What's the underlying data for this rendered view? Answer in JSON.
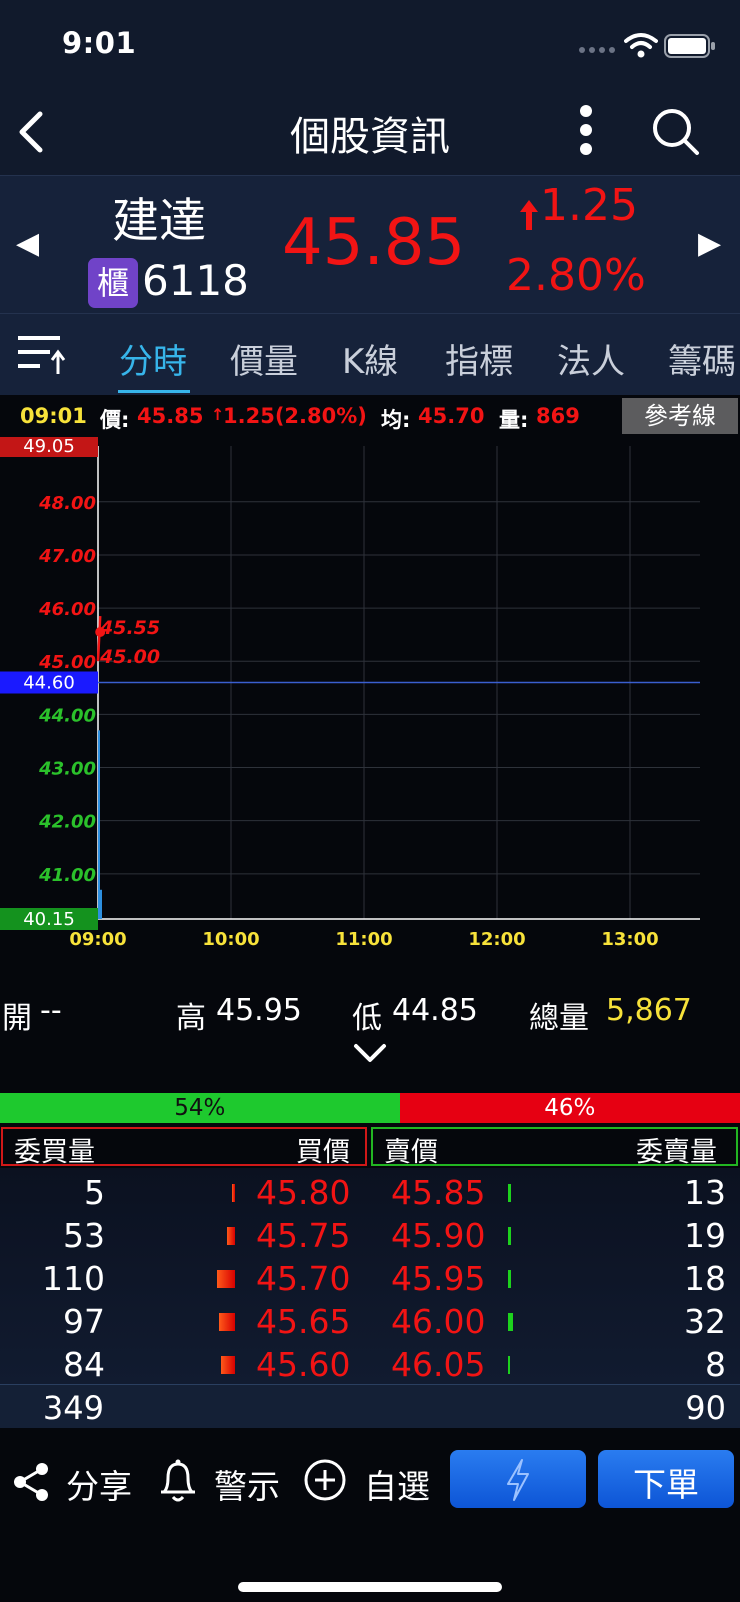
{
  "status": {
    "time": "9:01"
  },
  "nav": {
    "title": "個股資訊"
  },
  "quote": {
    "name": "建達",
    "market": "櫃",
    "code": "6118",
    "price": "45.85",
    "change": "1.25",
    "change_pct": "2.80%"
  },
  "tabs": [
    {
      "label": "分時"
    },
    {
      "label": "價量"
    },
    {
      "label": "K線"
    },
    {
      "label": "指標"
    },
    {
      "label": "法人"
    },
    {
      "label": "籌碼"
    }
  ],
  "info": {
    "time": "09:01",
    "price_label": "價:",
    "price": "45.85",
    "change": "1.25(2.80%)",
    "avg_label": "均:",
    "avg": "45.70",
    "vol_label": "量:",
    "vol": "869",
    "ref_button": "參考線"
  },
  "chart_data": {
    "type": "line",
    "y_upper_limit": "49.05",
    "y_lower_limit": "40.15",
    "y_reference": "44.60",
    "y_ticks": [
      "48.00",
      "47.00",
      "46.00",
      "45.00",
      "44.00",
      "43.00",
      "42.00",
      "41.00"
    ],
    "x_ticks": [
      "09:00",
      "10:00",
      "11:00",
      "12:00",
      "13:00"
    ],
    "ylim": [
      40.15,
      49.05
    ],
    "annotations": [
      {
        "label": "45.55",
        "value": 45.55
      },
      {
        "label": "45.00",
        "value": 45.0
      }
    ],
    "series": [
      {
        "x": [
          "09:00",
          "09:01"
        ],
        "values": [
          45.0,
          45.85
        ]
      }
    ],
    "colors": {
      "up": "#f21414",
      "down": "#2bc12b",
      "reference": "#1a1aff"
    }
  },
  "ohlc": {
    "open_label": "開",
    "open": "--",
    "high_label": "高",
    "high": "45.95",
    "low_label": "低",
    "low": "44.85",
    "vol_label": "總量",
    "vol": "5,867"
  },
  "ratio": {
    "buy": "54%",
    "sell": "46%",
    "buy_fraction": 0.54
  },
  "book": {
    "headers": {
      "bid_vol": "委買量",
      "bid": "買價",
      "ask": "賣價",
      "ask_vol": "委賣量"
    },
    "rows": [
      {
        "bid_vol": "5",
        "bid": "45.80",
        "ask": "45.85",
        "ask_vol": "13"
      },
      {
        "bid_vol": "53",
        "bid": "45.75",
        "ask": "45.90",
        "ask_vol": "19"
      },
      {
        "bid_vol": "110",
        "bid": "45.70",
        "ask": "45.95",
        "ask_vol": "18"
      },
      {
        "bid_vol": "97",
        "bid": "45.65",
        "ask": "46.00",
        "ask_vol": "32"
      },
      {
        "bid_vol": "84",
        "bid": "45.60",
        "ask": "46.05",
        "ask_vol": "8"
      }
    ],
    "total_bid": "349",
    "total_ask": "90"
  },
  "bottom": {
    "share": "分享",
    "alert": "警示",
    "watch": "自選",
    "order": "下單"
  }
}
